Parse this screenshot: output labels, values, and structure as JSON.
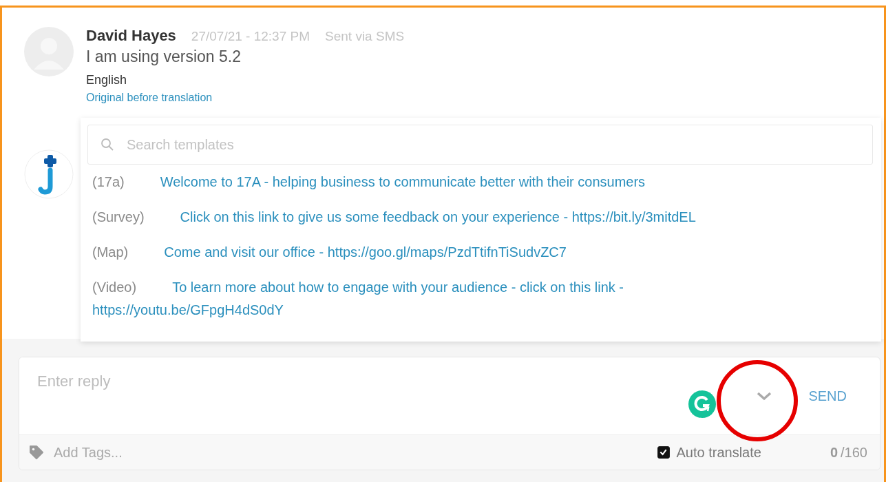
{
  "message": {
    "author": "David Hayes",
    "time": "27/07/21 - 12:37 PM",
    "channel": "Sent via SMS",
    "text": "I am using version 5.2",
    "language": "English",
    "original_link": "Original before translation"
  },
  "templates": {
    "search_placeholder": "Search templates",
    "items": [
      {
        "tag": "(17a)",
        "text": "Welcome to 17A - helping business to communicate better with their consumers"
      },
      {
        "tag": "(Survey)",
        "text": "Click on this link to give us some feedback on your experience - https://bit.ly/3mitdEL"
      },
      {
        "tag": "(Map)",
        "text": "Come and visit our office - https://goo.gl/maps/PzdTtifnTiSudvZC7"
      },
      {
        "tag": "(Video)",
        "text": "To learn more about how to engage with your audience - click on this link - https://youtu.be/GFpgH4dS0dY"
      }
    ]
  },
  "reply": {
    "placeholder": "Enter reply",
    "send_label": "SEND",
    "tags_placeholder": "Add Tags...",
    "auto_translate": {
      "label": "Auto translate",
      "checked": true
    },
    "count_used": "0",
    "count_limit": "/160"
  },
  "annotation": {
    "kind": "circle"
  }
}
